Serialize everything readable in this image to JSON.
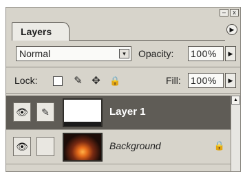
{
  "window": {
    "minimize_glyph": "–",
    "close_glyph": "x"
  },
  "panel": {
    "tab_label": "Layers",
    "menu_arrow_glyph": "▶"
  },
  "blend": {
    "mode": "Normal",
    "dropdown_glyph": "▾",
    "opacity_label": "Opacity:",
    "opacity_value": "100%",
    "opacity_arrow_glyph": "▶"
  },
  "lock": {
    "label": "Lock:",
    "icons": [
      "transparency-lock-icon",
      "brush-lock-icon",
      "move-lock-icon",
      "padlock-icon"
    ],
    "brush_glyph": "✎",
    "move_glyph": "✥",
    "padlock_glyph": "🔒",
    "fill_label": "Fill:",
    "fill_value": "100%",
    "fill_arrow_glyph": "▶"
  },
  "layers": [
    {
      "name": "Layer 1",
      "selected": true,
      "visible_glyph": "👁",
      "brush_glyph": "✎"
    },
    {
      "name": "Background",
      "selected": false,
      "visible_glyph": "👁",
      "lock_glyph": "🔒"
    }
  ],
  "scrollbar": {
    "up_glyph": "▲"
  },
  "colors": {
    "panel_bg": "#d7d4cb",
    "selected_row": "#5f5c56",
    "tab_bg": "#ecebe6"
  }
}
